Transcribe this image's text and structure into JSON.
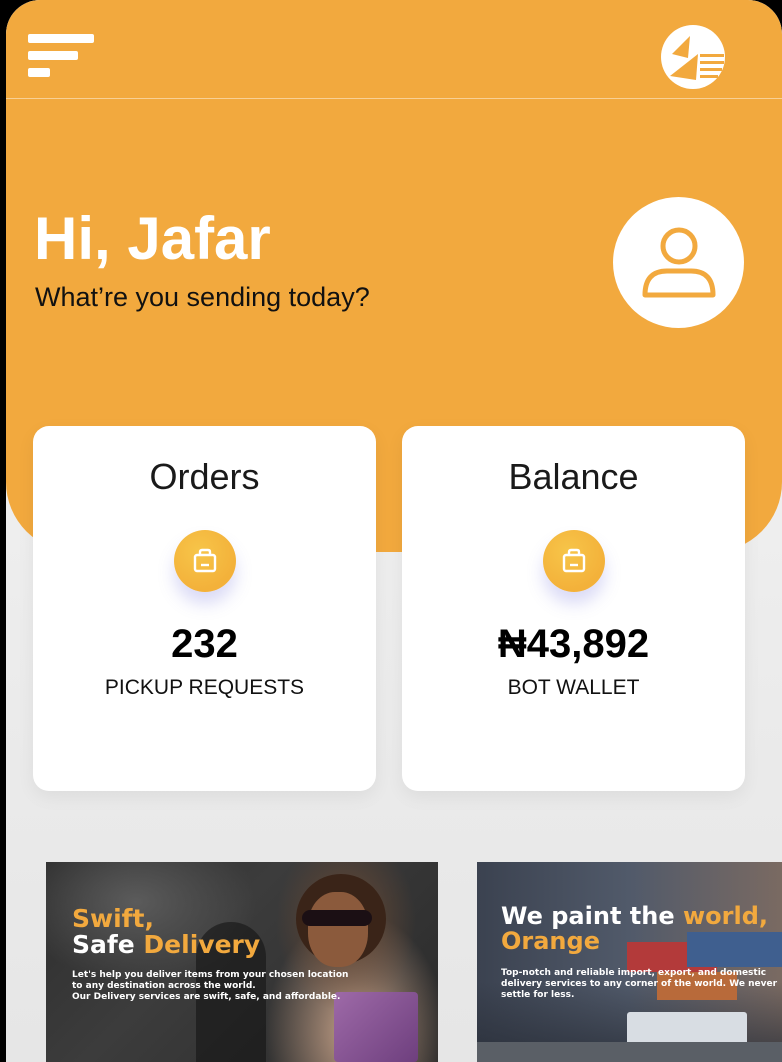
{
  "colors": {
    "brand_orange": "#f2a93e",
    "icon_yellow": "#f3b13a",
    "card_bg": "#ffffff",
    "page_bg": "#ececec"
  },
  "header": {
    "menu_icon": "menu-icon",
    "logo_icon": "brand-logo-icon"
  },
  "greeting": {
    "title": "Hi, Jafar",
    "subtitle": "What’re you sending today?",
    "avatar_icon": "user-icon"
  },
  "cards": [
    {
      "title": "Orders",
      "icon": "shopping-bag-icon",
      "value": "232",
      "label": "PICKUP REQUESTS"
    },
    {
      "title": "Balance",
      "icon": "shopping-bag-icon",
      "value": "₦43,892",
      "label": "BOT WALLET"
    }
  ],
  "banners": [
    {
      "heading_line1": "Swift,",
      "heading_line2_part1": "Safe ",
      "heading_line2_part2": "Delivery",
      "text_line1": "Let's help you deliver items from your chosen location",
      "text_line2": "to any destination across the world.",
      "text_line3": "Our Delivery services are swift, safe, and affordable."
    },
    {
      "heading_line1_part1": "We paint the ",
      "heading_line1_part2": "world,",
      "heading_line2": "Orange",
      "text_line1": "Top-notch and reliable import, export, and domestic",
      "text_line2": "delivery services to any corner of the world. We never",
      "text_line3": "settle for less."
    }
  ]
}
